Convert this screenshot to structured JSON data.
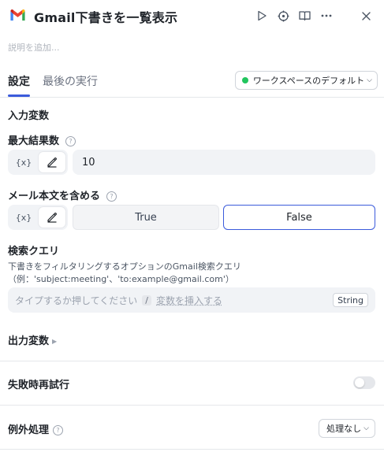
{
  "header": {
    "title": "Gmail下書きを一覧表示",
    "icons": [
      "gmail-logo",
      "play-icon",
      "target-icon",
      "book-icon",
      "more-icon",
      "close-icon"
    ]
  },
  "description": {
    "placeholder": "説明を追加..."
  },
  "tabs": [
    {
      "label": "設定",
      "active": true
    },
    {
      "label": "最後の実行",
      "active": false
    }
  ],
  "workspace": {
    "label": "ワークスペースのデフォルト",
    "status_color": "#22c55e"
  },
  "inputs_section": {
    "title": "入力変数"
  },
  "max_results": {
    "label": "最大結果数",
    "var_label": "{x}",
    "value": "10"
  },
  "include_body": {
    "label": "メール本文を含める",
    "var_label": "{x}",
    "options": [
      "True",
      "False"
    ],
    "selected": "False"
  },
  "search_query": {
    "label": "検索クエリ",
    "hint_line1": "下書きをフィルタリングするオプションのGmail検索クエリ",
    "hint_line2": "（例：'subject:meeting'、'to:example@gmail.com'）",
    "placeholder": "タイプするか押してください",
    "slash": "/",
    "insert_var": "変数を挿入する",
    "type_badge": "String"
  },
  "outputs_section": {
    "title": "出力変数"
  },
  "retry": {
    "label": "失敗時再試行",
    "enabled": false
  },
  "exception": {
    "label": "例外処理",
    "value": "処理なし"
  },
  "colors": {
    "accent": "#3b5bdb",
    "input_bg": "#f1f3f6",
    "text": "#1f2329"
  }
}
